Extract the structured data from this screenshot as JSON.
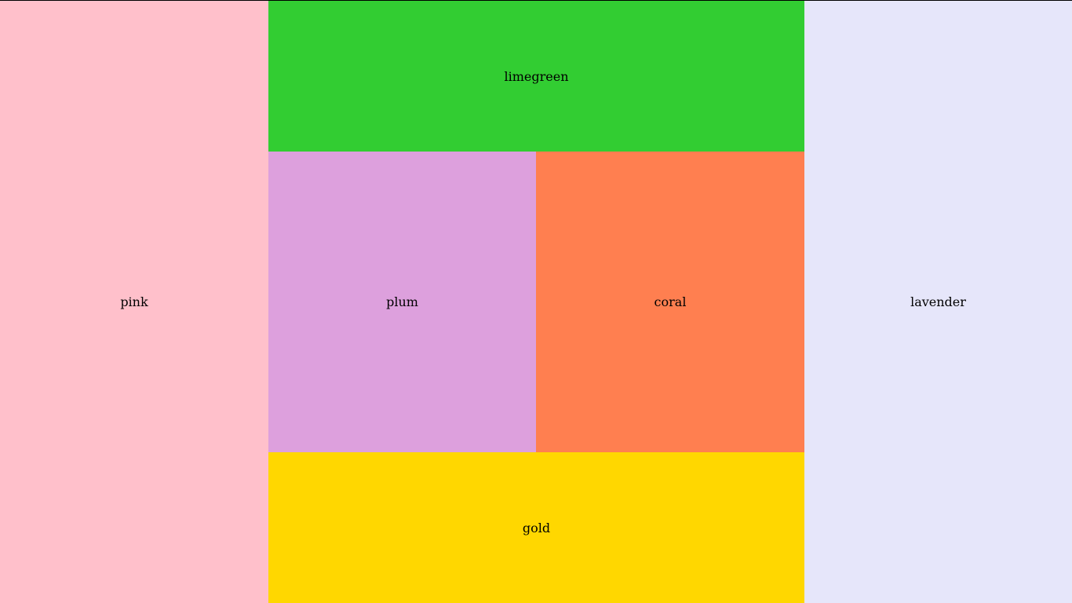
{
  "panels": {
    "pink": {
      "label": "pink",
      "color": "#ffc0cb"
    },
    "limegreen": {
      "label": "limegreen",
      "color": "#32cd32"
    },
    "plum": {
      "label": "plum",
      "color": "#dda0dd"
    },
    "coral": {
      "label": "coral",
      "color": "#ff7f50"
    },
    "gold": {
      "label": "gold",
      "color": "#ffd700"
    },
    "lavender": {
      "label": "lavender",
      "color": "#e6e6fa"
    }
  }
}
